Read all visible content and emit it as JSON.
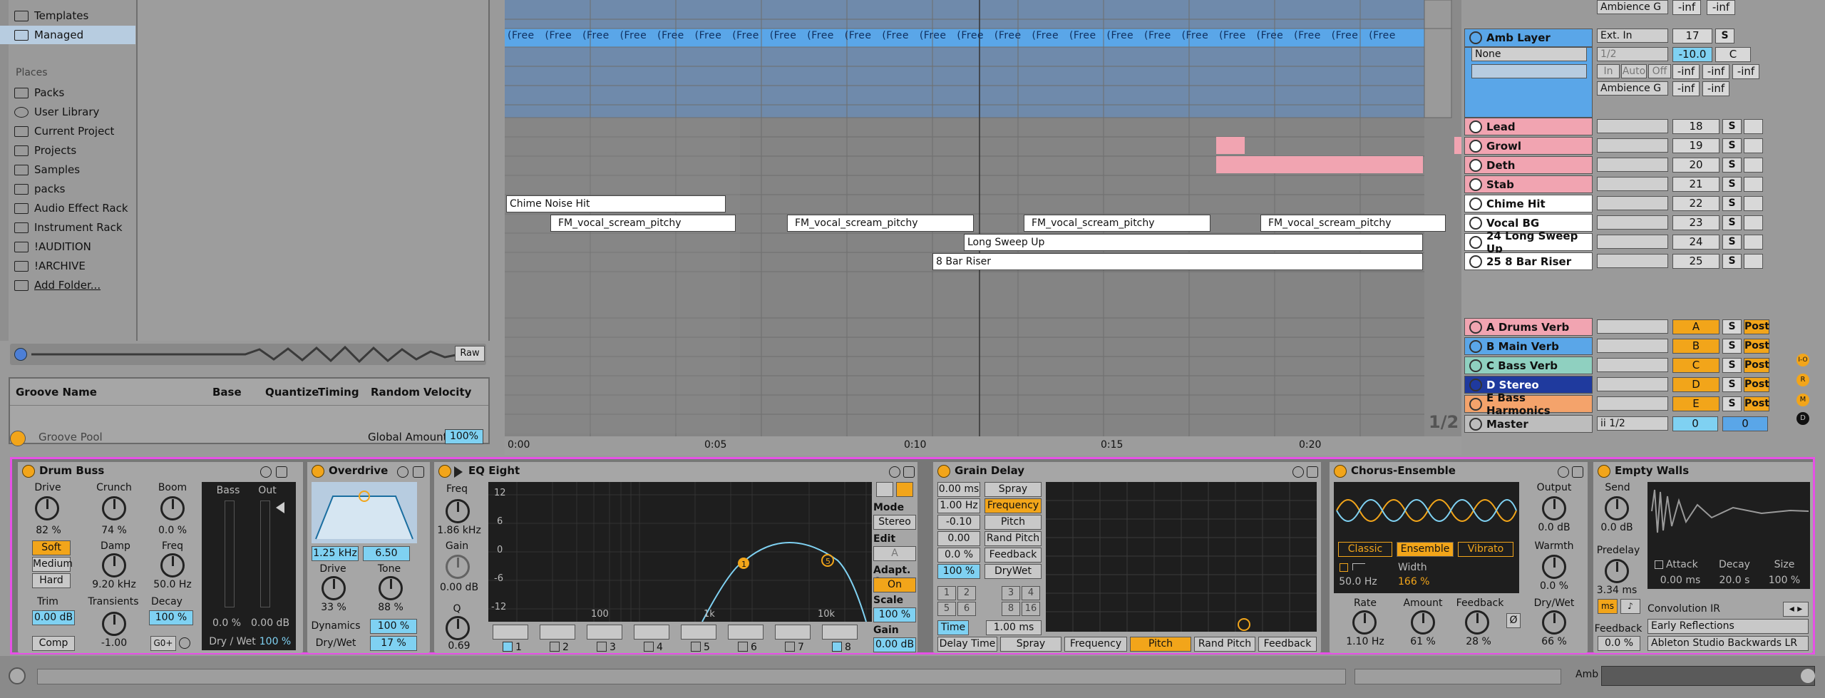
{
  "browser": {
    "top_items": [
      "Templates",
      "Managed"
    ],
    "places_title": "Places",
    "places": [
      "Packs",
      "User Library",
      "Current Project",
      "Projects",
      "Samples",
      "packs",
      "Audio Effect Rack",
      "Instrument Rack",
      "!AUDITION",
      "!ARCHIVE",
      "Add Folder..."
    ],
    "raw_label": "Raw"
  },
  "groove": {
    "headers": [
      "Groove Name",
      "Base",
      "Quantize",
      "Timing",
      "Random",
      "Velocity"
    ],
    "footer_label": "Groove Pool",
    "global_amount_label": "Global Amount",
    "global_amount_value": "100%"
  },
  "arrangement": {
    "freeze_clip_label": "(Free",
    "clips": [
      {
        "label": "Chime Noise Hit"
      },
      {
        "label": "FM_vocal_scream_pitchy"
      },
      {
        "label": "FM_vocal_scream_pitchy"
      },
      {
        "label": "FM_vocal_scream_pitchy"
      },
      {
        "label": "FM_vocal_scream_pitchy"
      },
      {
        "label": "Long Sweep Up"
      },
      {
        "label": "8 Bar Riser"
      }
    ],
    "ruler": [
      "0:00",
      "0:05",
      "0:10",
      "0:15",
      "0:20"
    ],
    "page_indicator": "1/2"
  },
  "mixer": {
    "top_input_1": "Ambience G",
    "top_vals_1": [
      "-inf",
      "-inf"
    ],
    "amb_layer": {
      "name": "Amb Layer",
      "input": "Ext. In",
      "number": "17",
      "solo": "S",
      "sub_input": "None",
      "sub_chan": "1/2",
      "vol": "-10.0",
      "pan": "C",
      "monitor": [
        "In",
        "Auto",
        "Off"
      ],
      "out": "Ambience G",
      "sends": [
        "-inf",
        "-inf",
        "-inf"
      ],
      "sends2": [
        "-inf",
        "-inf"
      ]
    },
    "tracks": [
      {
        "name": "Lead",
        "number": "18",
        "solo": "S",
        "color": "#f1a4b1"
      },
      {
        "name": "Growl",
        "number": "19",
        "solo": "S",
        "color": "#f1a4b1"
      },
      {
        "name": "Deth",
        "number": "20",
        "solo": "S",
        "color": "#f1a4b1"
      },
      {
        "name": "Stab",
        "number": "21",
        "solo": "S",
        "color": "#f1a4b1"
      },
      {
        "name": "Chime Hit",
        "number": "22",
        "solo": "S",
        "color": "#ffffff"
      },
      {
        "name": "Vocal BG",
        "number": "23",
        "solo": "S",
        "color": "#ffffff"
      },
      {
        "name": "24 Long Sweep Up",
        "number": "24",
        "solo": "S",
        "color": "#ffffff"
      },
      {
        "name": "25 8 Bar Riser",
        "number": "25",
        "solo": "S",
        "color": "#ffffff"
      }
    ],
    "returns": [
      {
        "name": "A Drums Verb",
        "letter": "A",
        "solo": "S",
        "post": "Post",
        "color": "#f1a4b1"
      },
      {
        "name": "B Main Verb",
        "letter": "B",
        "solo": "S",
        "post": "Post",
        "color": "#5aa6e8"
      },
      {
        "name": "C Bass Verb",
        "letter": "C",
        "solo": "S",
        "post": "Post",
        "color": "#8fd0c0"
      },
      {
        "name": "D Stereo",
        "letter": "D",
        "solo": "S",
        "post": "Post",
        "color": "#1f3a9e"
      },
      {
        "name": "E Bass Harmonics",
        "letter": "E",
        "solo": "S",
        "post": "Post",
        "color": "#f4a36b"
      }
    ],
    "master": {
      "name": "Master",
      "out": "ii 1/2",
      "vol": "0",
      "pan": "0"
    },
    "side_letters": [
      "I-O",
      "R",
      "M",
      "D"
    ]
  },
  "devices": {
    "drum_buss": {
      "title": "Drum Buss",
      "drive_label": "Drive",
      "drive_val": "82 %",
      "crunch_label": "Crunch",
      "crunch_val": "74 %",
      "boom_label": "Boom",
      "boom_val": "0.0 %",
      "modes": [
        "Soft",
        "Medium",
        "Hard"
      ],
      "damp_label": "Damp",
      "damp_val": "9.20 kHz",
      "freq_label": "Freq",
      "freq_val": "50.0 Hz",
      "trim_label": "Trim",
      "trim_val": "0.00 dB",
      "transients_label": "Transients",
      "transients_val": "-1.00",
      "decay_label": "Decay",
      "decay_val": "100 %",
      "comp_label": "Comp",
      "g0_label": "G0+",
      "bass_label": "Bass",
      "out_label": "Out",
      "bass_val": "0.0 %",
      "out_val": "0.00 dB",
      "drywet_label": "Dry / Wet",
      "drywet_val": "100 %"
    },
    "overdrive": {
      "title": "Overdrive",
      "freq_val": "1.25 kHz",
      "width_val": "6.50",
      "drive_label": "Drive",
      "drive_val": "33 %",
      "tone_label": "Tone",
      "tone_val": "88 %",
      "dynamics_label": "Dynamics",
      "dynamics_val": "100 %",
      "drywet_label": "Dry/Wet",
      "drywet_val": "17 %"
    },
    "eq_eight": {
      "title": "EQ Eight",
      "freq_label": "Freq",
      "freq_val": "1.86 kHz",
      "gain_label": "Gain",
      "gain_val": "0.00 dB",
      "q_label": "Q",
      "q_val": "0.69",
      "db_ticks": [
        "12",
        "6",
        "0",
        "-6",
        "-12"
      ],
      "freq_ticks": [
        "100",
        "1k",
        "10k"
      ],
      "mode_label": "Mode",
      "mode_val": "Stereo",
      "edit_label": "Edit",
      "edit_val": "A",
      "adaptq_label": "Adapt. Q",
      "adaptq_val": "On",
      "scale_label": "Scale",
      "scale_val": "100 %",
      "out_gain_label": "Gain",
      "out_gain_val": "0.00 dB",
      "bands": [
        "1",
        "2",
        "3",
        "4",
        "5",
        "6",
        "7",
        "8"
      ],
      "node_labels": [
        "1",
        "5"
      ]
    },
    "grain_delay": {
      "title": "Grain Delay",
      "vals": [
        "0.00 ms",
        "1.00 Hz",
        "-0.10",
        "0.00",
        "0.0 %",
        "100 %"
      ],
      "buttons": [
        "Spray",
        "Frequency",
        "Pitch",
        "Rand Pitch",
        "Feedback",
        "DryWet"
      ],
      "beats": [
        "1",
        "2",
        "3",
        "4",
        "5",
        "6",
        "8",
        "16"
      ],
      "time_label": "Time",
      "time_val": "1.00 ms",
      "xy_x": [
        "Delay Time",
        "Spray",
        "Frequency",
        "Pitch",
        "Rand Pitch",
        "Feedback"
      ]
    },
    "chorus": {
      "title": "Chorus-Ensemble",
      "modes": [
        "Classic",
        "Ensemble",
        "Vibrato"
      ],
      "hz_val": "50.0 Hz",
      "width_label": "Width",
      "width_val": "166 %",
      "output_label": "Output",
      "output_val": "0.0 dB",
      "warmth_label": "Warmth",
      "warmth_val": "0.0 %",
      "rate_label": "Rate",
      "rate_val": "1.10 Hz",
      "amount_label": "Amount",
      "amount_val": "61 %",
      "feedback_label": "Feedback",
      "feedback_val": "28 %",
      "phase_label": "Ø",
      "drywet_label": "Dry/Wet",
      "drywet_val": "66 %"
    },
    "empty_walls": {
      "title": "Empty Walls",
      "send_label": "Send",
      "send_val": "0.0 dB",
      "predelay_label": "Predelay",
      "predelay_val": "3.34 ms",
      "ms_label": "ms",
      "attack_label": "Attack",
      "attack_val": "0.00 ms",
      "decay_label": "Decay",
      "decay_val": "20.0 s",
      "size_label": "Size",
      "size_val": "100 %",
      "feedback_label": "Feedback",
      "feedback_val": "0.0 %",
      "conv_label": "Convolution IR",
      "ir_type": "Early Reflections",
      "ir_name": "Ableton Studio Backwards LR"
    }
  },
  "bottom": {
    "track_label": "Amb"
  },
  "colors": {
    "accent_orange": "#f2a51a",
    "accent_blue": "#7fd1f2",
    "selection_border": "#e651e6"
  }
}
